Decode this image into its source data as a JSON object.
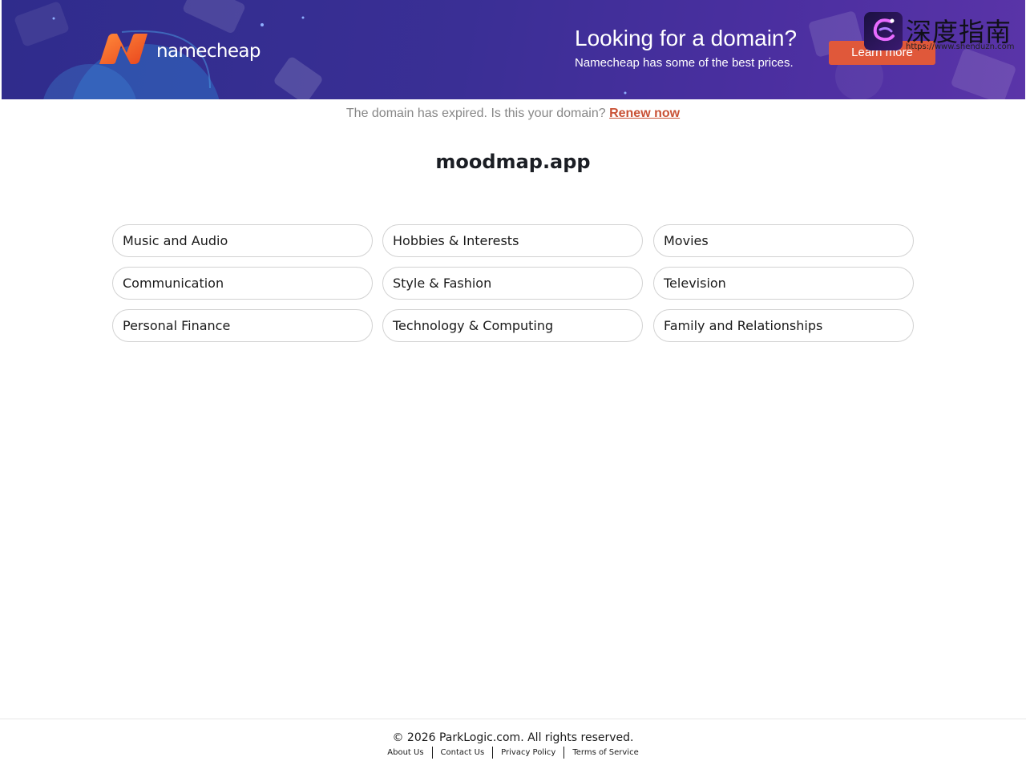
{
  "banner": {
    "logo_text": "namecheap",
    "ad_title": "Looking for a domain?",
    "ad_subtitle": "Namecheap has some of the best prices.",
    "learn_more": "Learn more",
    "watermark_text": "深度指南",
    "watermark_url": "https://www.shenduzn.com"
  },
  "notice": {
    "text": "The domain has expired. Is this your domain?",
    "renew_link": "Renew now"
  },
  "domain": "moodmap.app",
  "categories": [
    "Music and Audio",
    "Hobbies & Interests",
    "Movies",
    "Communication",
    "Style & Fashion",
    "Television",
    "Personal Finance",
    "Technology & Computing",
    "Family and Relationships"
  ],
  "footer": {
    "copyright": "© 2026 ParkLogic.com. All rights reserved.",
    "links": [
      "About Us",
      "Contact Us",
      "Privacy Policy",
      "Terms of Service"
    ]
  },
  "colors": {
    "accent": "#e0583a",
    "renew_link": "#c95135",
    "banner_bg": "#3a2f95",
    "logo_orange": "#f0612f"
  }
}
